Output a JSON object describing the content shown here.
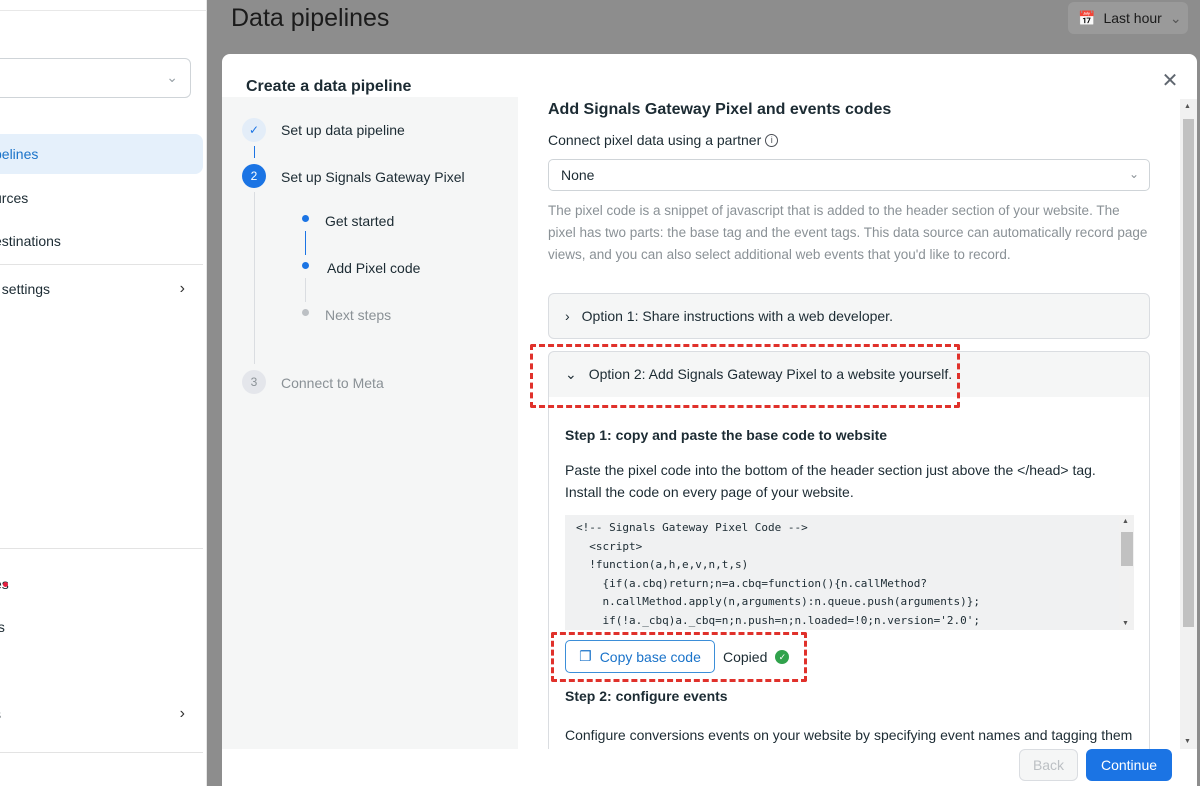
{
  "background": {
    "page_title": "Data pipelines",
    "time_filter": "Last hour",
    "nav_items": [
      "pelines",
      "urces",
      "estinations",
      "t settings"
    ],
    "bottom_items": [
      "es",
      "ts",
      "s"
    ]
  },
  "modal": {
    "title": "Create a data pipeline",
    "steps": [
      {
        "number": "",
        "label": "Set up data pipeline",
        "state": "done"
      },
      {
        "number": "2",
        "label": "Set up Signals Gateway Pixel",
        "state": "active"
      },
      {
        "number": "3",
        "label": "Connect to Meta",
        "state": "pending"
      }
    ],
    "substeps": [
      {
        "label": "Get started",
        "state": "done"
      },
      {
        "label": "Add Pixel code",
        "state": "active"
      },
      {
        "label": "Next steps",
        "state": "pending"
      }
    ],
    "content": {
      "title": "Add Signals Gateway Pixel and events codes",
      "partner_label": "Connect pixel data using a partner",
      "partner_value": "None",
      "description": "The pixel code is a snippet of javascript that is added to the header section of your website. The pixel has two parts: the base tag and the event tags. This data source can automatically record page views, and you can also select additional web events that you'd like to record.",
      "option1": "Option 1: Share instructions with a web developer.",
      "option2": "Option 2: Add Signals Gateway Pixel to a website yourself.",
      "step1_title": "Step 1: copy and paste the base code to website",
      "step1_desc": "Paste the pixel code into the bottom of the header section just above the </head> tag. Install the code on every page of your website.",
      "code": "<!-- Signals Gateway Pixel Code -->\n  <script>\n  !function(a,h,e,v,n,t,s)\n    {if(a.cbq)return;n=a.cbq=function(){n.callMethod?\n    n.callMethod.apply(n,arguments):n.queue.push(arguments)};\n    if(!a._cbq)a._cbq=n;n.push=n;n.loaded=!0;n.version='2.0';",
      "copy_button": "Copy base code",
      "copied_status": "Copied",
      "step2_title": "Step 2: configure events",
      "step2_desc": "Configure conversions events on your website by specifying event names and tagging them in your code."
    },
    "footer": {
      "back": "Back",
      "continue": "Continue"
    }
  },
  "colors": {
    "accent": "#1b74e4",
    "highlight": "#e0312b",
    "success": "#31a24c"
  }
}
